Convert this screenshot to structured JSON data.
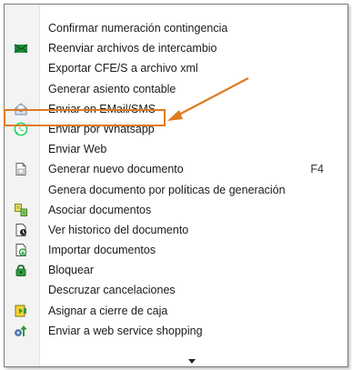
{
  "menu": {
    "items": [
      {
        "label": "Confirmar numeración contingencia",
        "icon": ""
      },
      {
        "label": "Reenviar archivos de intercambio",
        "icon": "green-envelope-icon"
      },
      {
        "label": "Exportar CFE/S a archivo xml",
        "icon": ""
      },
      {
        "label": "Generar asiento contable",
        "icon": ""
      },
      {
        "label": "Enviar en EMail/SMS",
        "icon": "mail-icon"
      },
      {
        "label": "Enviar por Whatsapp",
        "icon": "whatsapp-icon"
      },
      {
        "label": "Enviar Web",
        "icon": ""
      },
      {
        "label": "Generar nuevo documento",
        "icon": "new-document-icon",
        "shortcut": "F4"
      },
      {
        "label": "Genera documento por políticas de generación",
        "icon": ""
      },
      {
        "label": "Asociar documentos",
        "icon": "associate-documents-icon"
      },
      {
        "label": "Ver historico del documento",
        "icon": "document-history-icon"
      },
      {
        "label": "Importar documentos",
        "icon": "import-documents-icon"
      },
      {
        "label": "Bloquear",
        "icon": "lock-icon"
      },
      {
        "label": "Descruzar cancelaciones",
        "icon": ""
      },
      {
        "label": "Asignar a cierre de caja",
        "icon": "cash-close-icon"
      },
      {
        "label": "Enviar a web service shopping",
        "icon": "web-service-icon"
      }
    ]
  },
  "colors": {
    "annotation": "#e07a1f",
    "whatsapp": "#25d366",
    "green": "#2e9b3a"
  }
}
